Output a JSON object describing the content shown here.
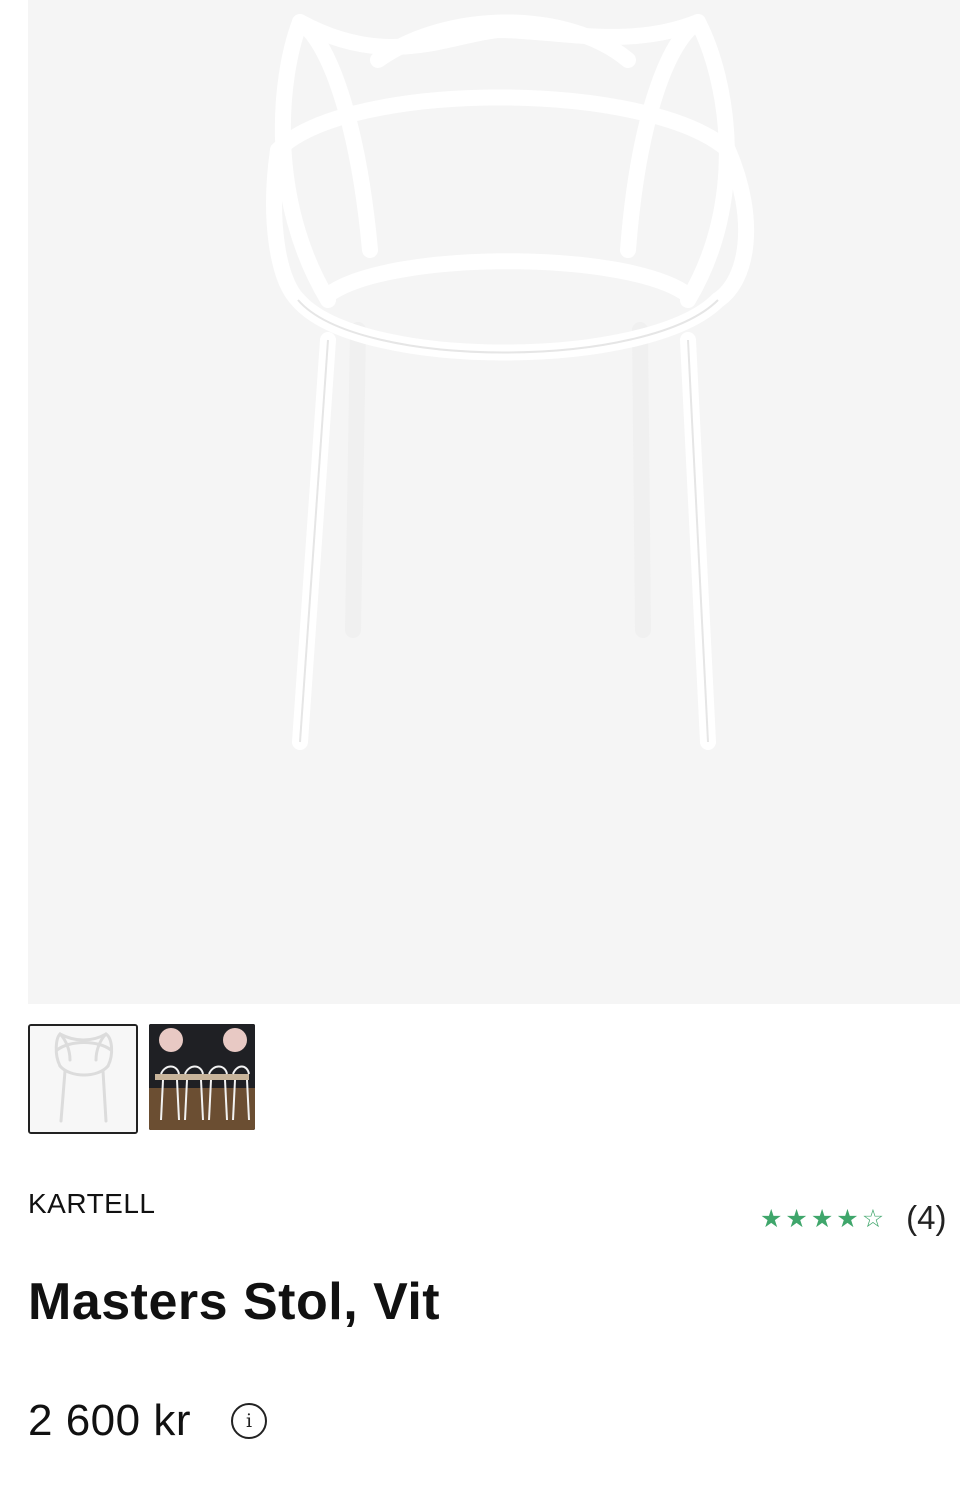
{
  "product": {
    "brand": "KARTELL",
    "name": "Masters Stol, Vit",
    "price": "2 600 kr",
    "rating": {
      "stars": 4,
      "max": 5,
      "count_label": "(4)"
    }
  },
  "gallery": {
    "selected_index": 0,
    "thumbnails": [
      {
        "kind": "product-on-white"
      },
      {
        "kind": "dining-room-scene"
      }
    ]
  },
  "icons": {
    "info": "info-icon",
    "star_filled": "star-filled-icon",
    "star_empty": "star-empty-icon"
  },
  "colors": {
    "star": "#3fa66b",
    "text": "#111111",
    "hero_bg": "#f5f5f5",
    "thumb_border_selected": "#222222"
  }
}
